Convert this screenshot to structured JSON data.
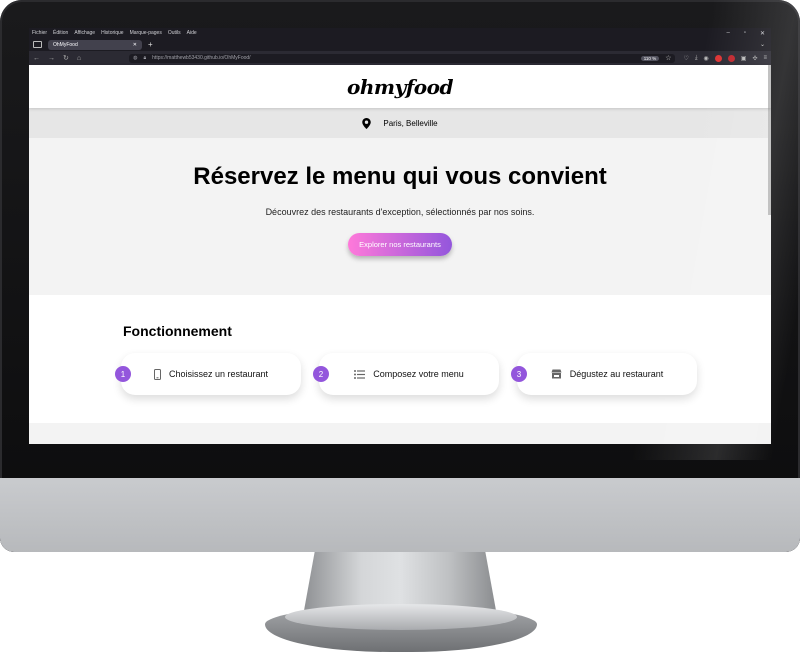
{
  "browser": {
    "menu": [
      "Fichier",
      "Édition",
      "Affichage",
      "Historique",
      "Marque-pages",
      "Outils",
      "Aide"
    ],
    "window_controls": [
      "–",
      "▫",
      "✕"
    ],
    "tab_title": "OhMyFood",
    "tab_close": "✕",
    "new_tab": "+",
    "url": "https://matthewb53430.github.io/OhMyFood/",
    "zoom": "110 %"
  },
  "header": {
    "logo": "ohmyfood"
  },
  "location": {
    "text": "Paris, Belleville"
  },
  "hero": {
    "title": "Réservez le menu qui vous convient",
    "subtitle": "Découvrez des restaurants d'exception, sélectionnés par nos soins.",
    "cta": "Explorer nos restaurants"
  },
  "how": {
    "title": "Fonctionnement",
    "steps": [
      {
        "num": "1",
        "label": "Choisissez un restaurant",
        "icon": "mobile-phone-icon"
      },
      {
        "num": "2",
        "label": "Composez votre menu",
        "icon": "list-icon"
      },
      {
        "num": "3",
        "label": "Dégustez au restaurant",
        "icon": "store-icon"
      }
    ]
  },
  "colors": {
    "accent": "#9356dc",
    "cta_start": "#ff79da",
    "cta_end": "#9356dc",
    "location_bg": "#e6e6e6",
    "hero_bg": "#f3f3f3"
  }
}
